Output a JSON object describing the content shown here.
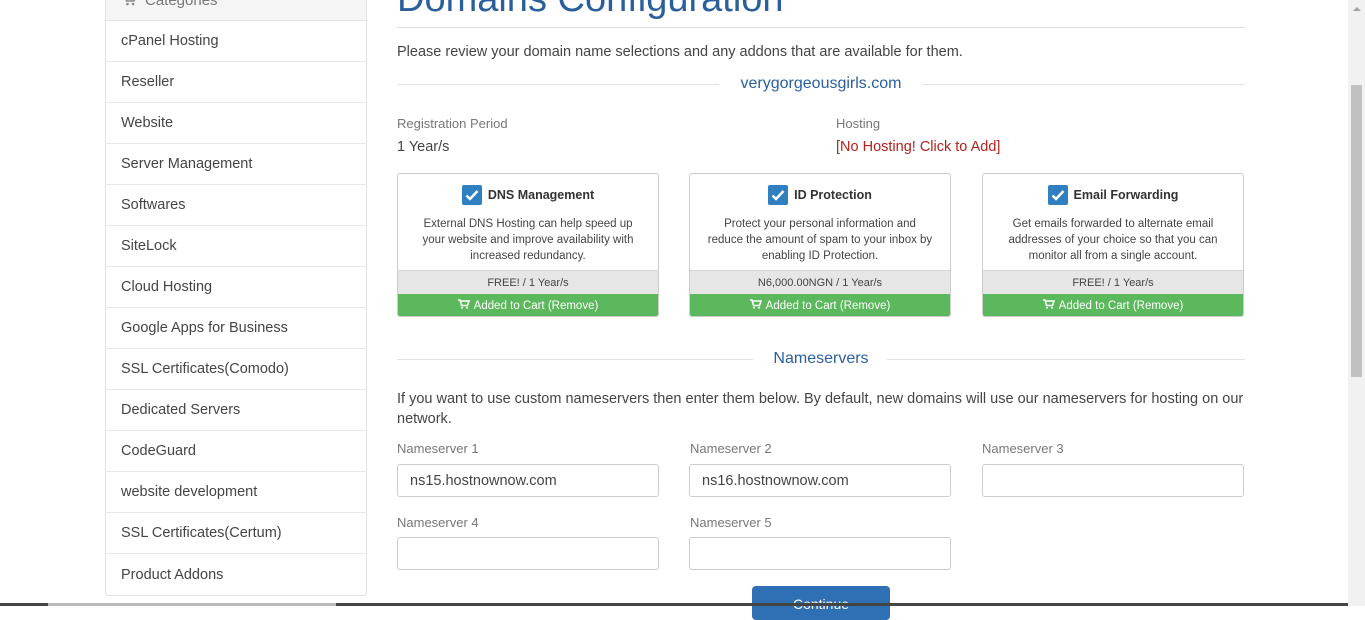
{
  "sidebar": {
    "header": "Categories",
    "items": [
      {
        "label": "cPanel Hosting"
      },
      {
        "label": "Reseller"
      },
      {
        "label": "Website"
      },
      {
        "label": "Server Management"
      },
      {
        "label": "Softwares"
      },
      {
        "label": "SiteLock"
      },
      {
        "label": "Cloud Hosting"
      },
      {
        "label": "Google Apps for Business"
      },
      {
        "label": "SSL Certificates(Comodo)"
      },
      {
        "label": "Dedicated Servers"
      },
      {
        "label": "CodeGuard"
      },
      {
        "label": "website development"
      },
      {
        "label": "SSL Certificates(Certum)"
      },
      {
        "label": "Product Addons"
      }
    ]
  },
  "main": {
    "title": "Domains Configuration",
    "intro": "Please review your domain name selections and any addons that are available for them.",
    "domain": "verygorgeousgirls.com",
    "registration_label": "Registration Period",
    "registration_value": "1 Year/s",
    "hosting_label": "Hosting",
    "hosting_value": "[No Hosting! Click to Add]",
    "addons": [
      {
        "title": "DNS Management",
        "description": "External DNS Hosting can help speed up your website and improve availability with increased redundancy.",
        "price": "FREE! / 1 Year/s",
        "button": "Added to Cart (Remove)"
      },
      {
        "title": "ID Protection",
        "description": "Protect your personal information and reduce the amount of spam to your inbox by enabling ID Protection.",
        "price": "N6,000.00NGN / 1 Year/s",
        "button": "Added to Cart (Remove)"
      },
      {
        "title": "Email Forwarding",
        "description": "Get emails forwarded to alternate email addresses of your choice so that you can monitor all from a single account.",
        "price": "FREE! / 1 Year/s",
        "button": "Added to Cart (Remove)"
      }
    ],
    "nameservers_heading": "Nameservers",
    "nameservers_intro": "If you want to use custom nameservers then enter them below. By default, new domains will use our nameservers for hosting on our network.",
    "nameservers": [
      {
        "label": "Nameserver 1",
        "value": "ns15.hostnownow.com"
      },
      {
        "label": "Nameserver 2",
        "value": "ns16.hostnownow.com"
      },
      {
        "label": "Nameserver 3",
        "value": ""
      },
      {
        "label": "Nameserver 4",
        "value": ""
      },
      {
        "label": "Nameserver 5",
        "value": ""
      }
    ],
    "continue_label": "Continue"
  },
  "colors": {
    "accent": "#2a5f9c",
    "success": "#5cb85c",
    "danger": "#b3221d",
    "checkbox": "#2f7fc1"
  }
}
